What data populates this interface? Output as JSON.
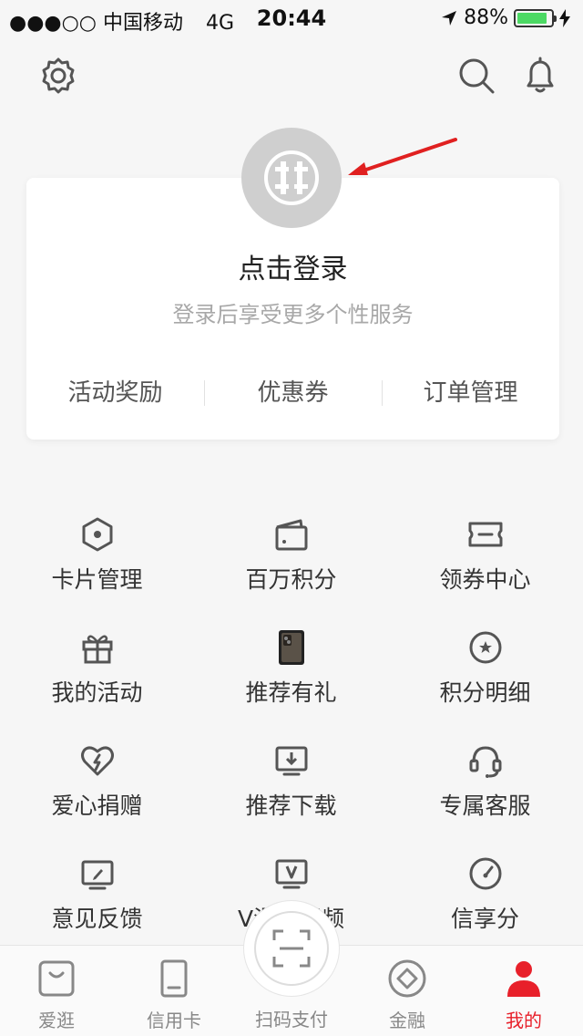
{
  "status_bar": {
    "carrier": "●●●○○ 中国移动",
    "network": "4G",
    "time": "20:44",
    "battery": "88%",
    "battery_level": 0.88,
    "battery_color": "#4cd964"
  },
  "header": {
    "icons": [
      "gear-icon",
      "search-icon",
      "bell-icon"
    ]
  },
  "login_card": {
    "title": "点击登录",
    "subtitle": "登录后享受更多个性服务",
    "links": [
      "活动奖励",
      "优惠券",
      "订单管理"
    ]
  },
  "grid": {
    "items": [
      {
        "label": "卡片管理",
        "icon": "hexagon-icon"
      },
      {
        "label": "百万积分",
        "icon": "wallet-icon"
      },
      {
        "label": "领券中心",
        "icon": "ticket-icon"
      },
      {
        "label": "我的活动",
        "icon": "gift-icon"
      },
      {
        "label": "推荐有礼",
        "icon": "phone-image"
      },
      {
        "label": "积分明细",
        "icon": "star-circle-icon"
      },
      {
        "label": "爱心捐赠",
        "icon": "heart-icon"
      },
      {
        "label": "推荐下载",
        "icon": "download-icon"
      },
      {
        "label": "专属客服",
        "icon": "headset-icon"
      },
      {
        "label": "意见反馈",
        "icon": "feedback-icon"
      },
      {
        "label": "V漫铺视频",
        "icon": "video-icon"
      },
      {
        "label": "信享分",
        "icon": "gauge-icon"
      }
    ]
  },
  "tab_bar": {
    "tabs": [
      {
        "label": "爱逛",
        "icon": "bag-icon"
      },
      {
        "label": "信用卡",
        "icon": "card-icon"
      },
      {
        "label": "扫码支付",
        "icon": "scan-icon"
      },
      {
        "label": "金融",
        "icon": "diamond-icon"
      },
      {
        "label": "我的",
        "icon": "user-icon"
      }
    ],
    "active_color": "#e8202a"
  }
}
